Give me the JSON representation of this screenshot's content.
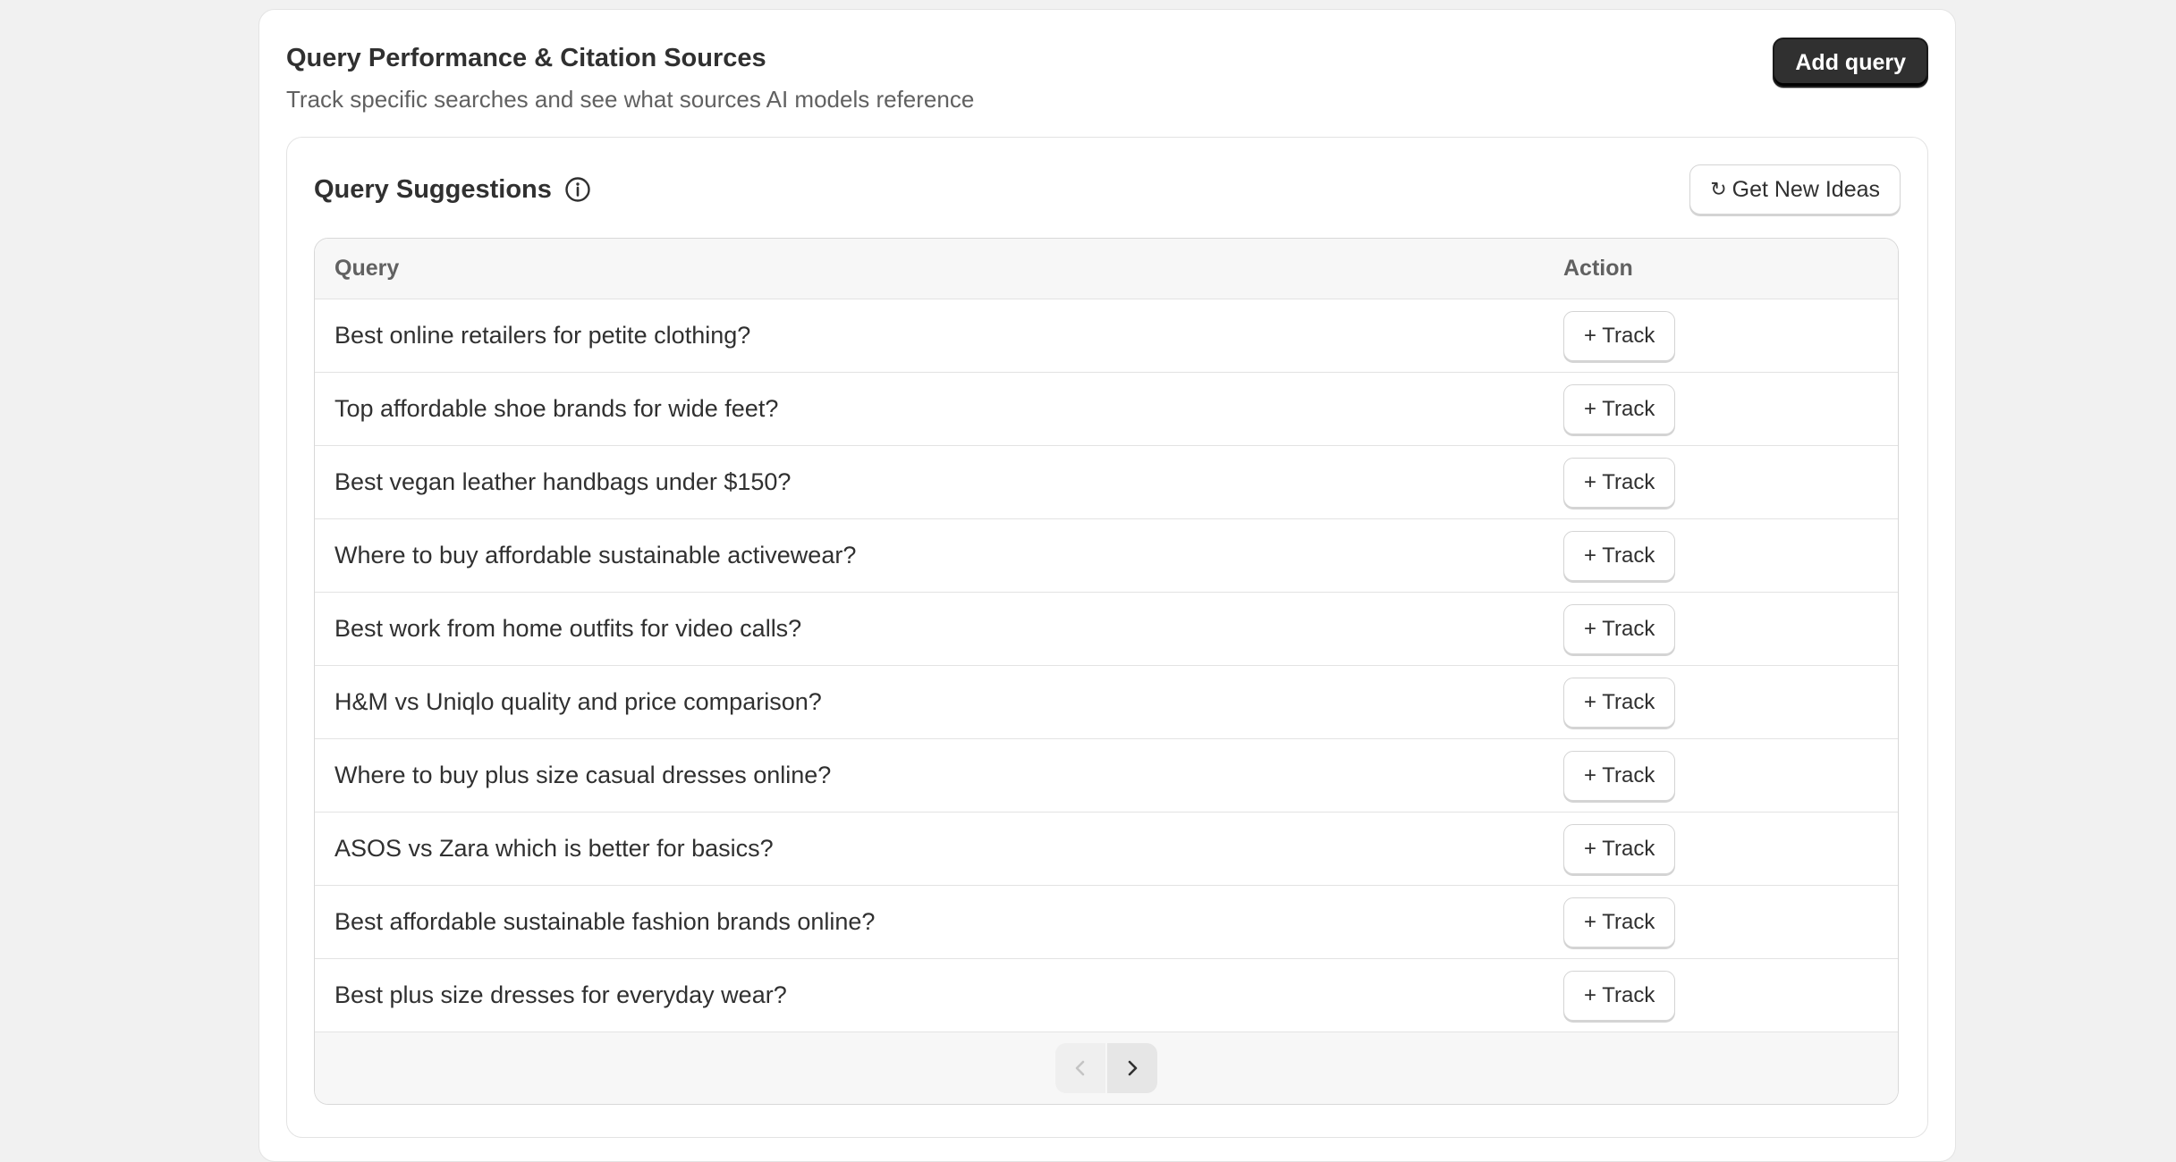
{
  "header": {
    "title": "Query Performance & Citation Sources",
    "subtitle": "Track specific searches and see what sources AI models reference",
    "add_query_label": "Add query"
  },
  "suggestions": {
    "title": "Query Suggestions",
    "info_icon": "info-circle-icon",
    "new_ideas_icon": "↻",
    "new_ideas_label": "Get New Ideas",
    "columns": {
      "query": "Query",
      "action": "Action"
    },
    "rows": [
      {
        "query": "Best online retailers for petite clothing?",
        "action": "+ Track"
      },
      {
        "query": "Top affordable shoe brands for wide feet?",
        "action": "+ Track"
      },
      {
        "query": "Best vegan leather handbags under $150?",
        "action": "+ Track"
      },
      {
        "query": "Where to buy affordable sustainable activewear?",
        "action": "+ Track"
      },
      {
        "query": "Best work from home outfits for video calls?",
        "action": "+ Track"
      },
      {
        "query": "H&M vs Uniqlo quality and price comparison?",
        "action": "+ Track"
      },
      {
        "query": "Where to buy plus size casual dresses online?",
        "action": "+ Track"
      },
      {
        "query": "ASOS vs Zara which is better for basics?",
        "action": "+ Track"
      },
      {
        "query": "Best affordable sustainable fashion brands online?",
        "action": "+ Track"
      },
      {
        "query": "Best plus size dresses for everyday wear?",
        "action": "+ Track"
      }
    ]
  },
  "pagination": {
    "prev_icon": "chevron-left-icon",
    "next_icon": "chevron-right-icon",
    "prev_enabled": false,
    "next_enabled": true
  },
  "colors": {
    "primary_button": "#303030",
    "background": "#f1f1f1",
    "card": "#ffffff"
  }
}
